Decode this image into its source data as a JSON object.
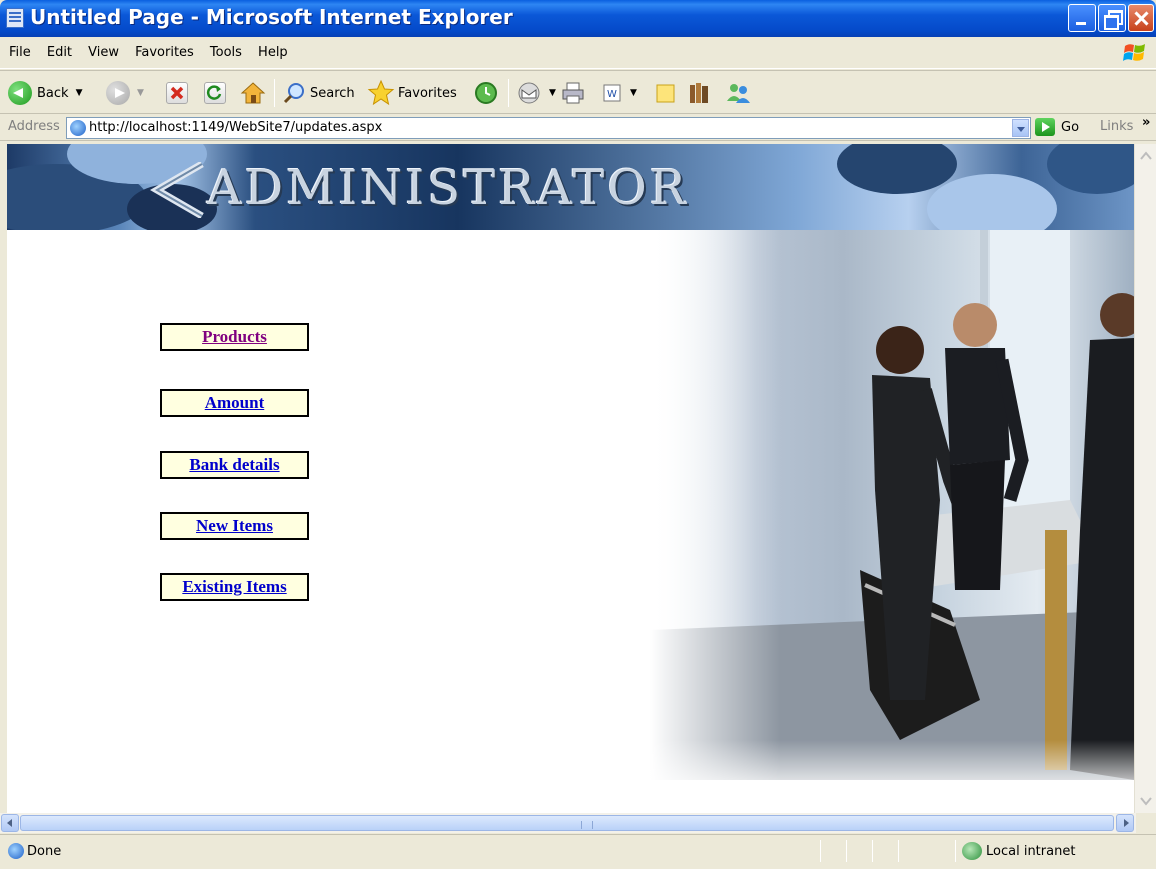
{
  "window": {
    "title": "Untitled Page - Microsoft Internet Explorer"
  },
  "menubar": {
    "items": [
      "File",
      "Edit",
      "View",
      "Favorites",
      "Tools",
      "Help"
    ]
  },
  "toolbar": {
    "back_label": "Back",
    "search_label": "Search",
    "favorites_label": "Favorites"
  },
  "addressbar": {
    "label": "Address",
    "url": "http://localhost:1149/WebSite7/updates.aspx",
    "go_label": "Go",
    "links_label": "Links",
    "chevron": "»"
  },
  "page": {
    "banner_text": "ADMINISTRATOR",
    "nav": [
      {
        "label": "Products",
        "visited": true
      },
      {
        "label": "Amount",
        "visited": false
      },
      {
        "label": "Bank details",
        "visited": false
      },
      {
        "label": "New Items",
        "visited": false
      },
      {
        "label": "Existing Items",
        "visited": false
      }
    ]
  },
  "statusbar": {
    "text": "Done",
    "zone": "Local intranet"
  },
  "colors": {
    "link": "#0000cc",
    "visited_link": "#800080",
    "nav_bg": "#ffffe0",
    "titlebar": "#0b58d8"
  }
}
